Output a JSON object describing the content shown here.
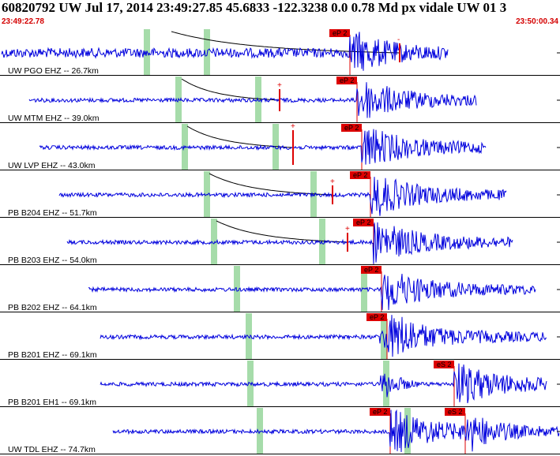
{
  "header": {
    "title": "60820792 UW Jul 17, 2014 23:49:27.85    45.6833 -122.3238  0.0 0.78 Md px vidale UW 01    3",
    "start_time": "23:49:22.78",
    "end_time": "23:50:00.34"
  },
  "colors": {
    "trace": "#0000dd",
    "pick_label_bg": "#dd0000",
    "pick_line": "#dd0000",
    "coda_curve": "#000000",
    "theoretical_band": "#a6dcaa",
    "separator": "#000000",
    "timestamp": "#d40000"
  },
  "channels": [
    {
      "label": "UW PGO EHZ -- 26.7km",
      "picks": [
        {
          "text": "eP 2",
          "time": 23.45
        }
      ],
      "amp": {
        "text": "-"
      }
    },
    {
      "label": "UW MTM EHZ -- 39.0km",
      "picks": [
        {
          "text": "eP 2",
          "time": 23.95
        }
      ],
      "amp": {
        "text": "+"
      }
    },
    {
      "label": "UW LVP EHZ -- 43.0km",
      "picks": [
        {
          "text": "eP 2",
          "time": 24.25
        }
      ],
      "amp": {
        "text": "+"
      }
    },
    {
      "label": "PB B204 EHZ -- 51.7km",
      "picks": [
        {
          "text": "eP 2",
          "time": 24.85
        }
      ],
      "amp": {
        "text": "+"
      }
    },
    {
      "label": "PB B203 EHZ -- 54.0km",
      "picks": [
        {
          "text": "eP 2",
          "time": 25.05
        }
      ],
      "amp": {
        "text": "+"
      }
    },
    {
      "label": "PB B202 EHZ -- 64.1km",
      "picks": [
        {
          "text": "eP 2",
          "time": 25.6
        }
      ],
      "amp": null
    },
    {
      "label": "PB B201 EHZ -- 69.1km",
      "picks": [
        {
          "text": "eP 2",
          "time": 25.95
        }
      ],
      "amp": null
    },
    {
      "label": "PB B201 EH1 -- 69.1km",
      "picks": [
        {
          "text": "eS 2",
          "time": 30.45
        }
      ],
      "amp": null
    },
    {
      "label": "UW TDL EHZ -- 74.7km",
      "picks": [
        {
          "text": "eP 2",
          "time": 26.15
        },
        {
          "text": "eS 2",
          "time": 31.2
        }
      ],
      "amp": null
    }
  ]
}
